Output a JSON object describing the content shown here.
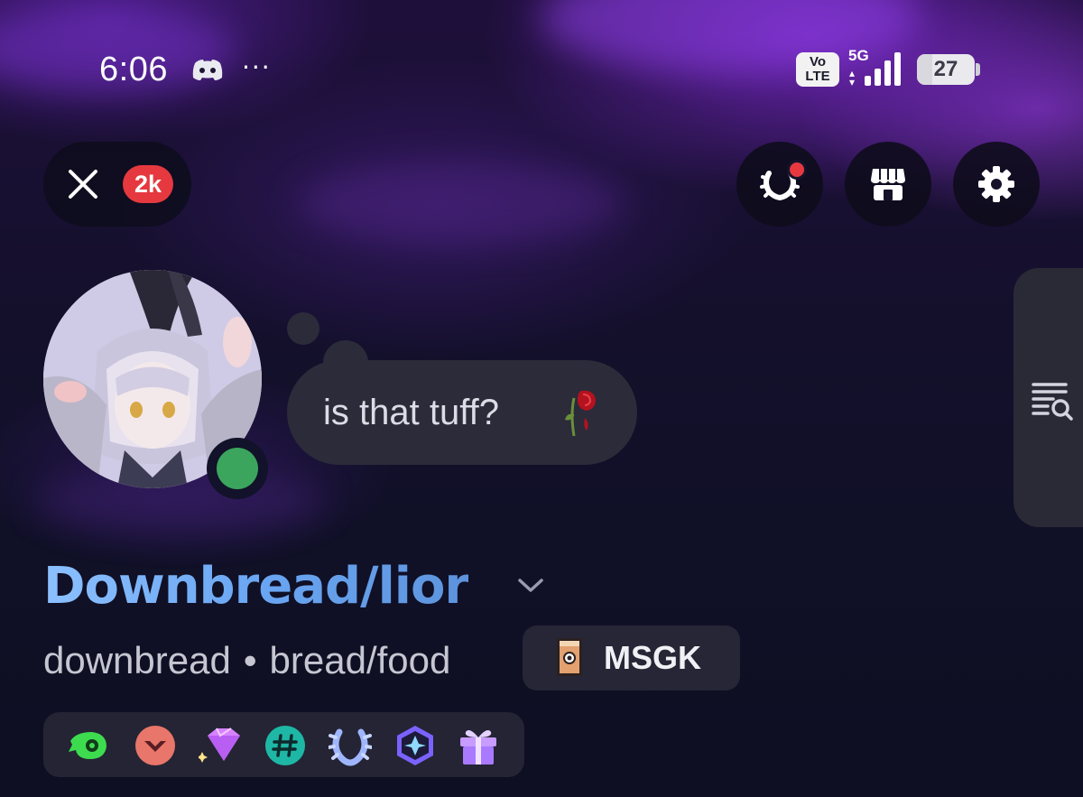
{
  "status_bar": {
    "time": "6:06",
    "more": "···",
    "volte_top": "Vo",
    "volte_bottom": "LTE",
    "network": "5G",
    "battery": "27",
    "battery_fraction": 0.27
  },
  "top_controls": {
    "notification_count": "2k",
    "nitro_icon": "laurel-icon",
    "shop_icon": "shop-icon",
    "settings_icon": "gear-icon"
  },
  "profile": {
    "custom_status": "is that tuff?",
    "custom_status_emoji": "wilted-rose",
    "display_name": "Downbread/lior",
    "username": "downbread",
    "separator": "•",
    "pronouns": "bread/food",
    "guild_tag": "MSGK",
    "presence": "online"
  },
  "badges": [
    {
      "name": "quests-badge-icon",
      "color": "#3ddc4f"
    },
    {
      "name": "hypesquad-badge-icon",
      "color": "#e8766a"
    },
    {
      "name": "nitro-gem-badge-icon",
      "color": "#d682ff"
    },
    {
      "name": "originally-known-as-badge-icon",
      "color": "#1eb7a5"
    },
    {
      "name": "nitro-laurel-badge-icon",
      "color": "#9fb6ff"
    },
    {
      "name": "server-boost-badge-icon",
      "color": "#7b62ff"
    },
    {
      "name": "gift-badge-icon",
      "color": "#b58bff"
    }
  ],
  "colors": {
    "online": "#3ba55d",
    "badge_red": "#e5393f",
    "name_gradient_start": "#8cc0ff",
    "name_gradient_end": "#5d93dd"
  }
}
